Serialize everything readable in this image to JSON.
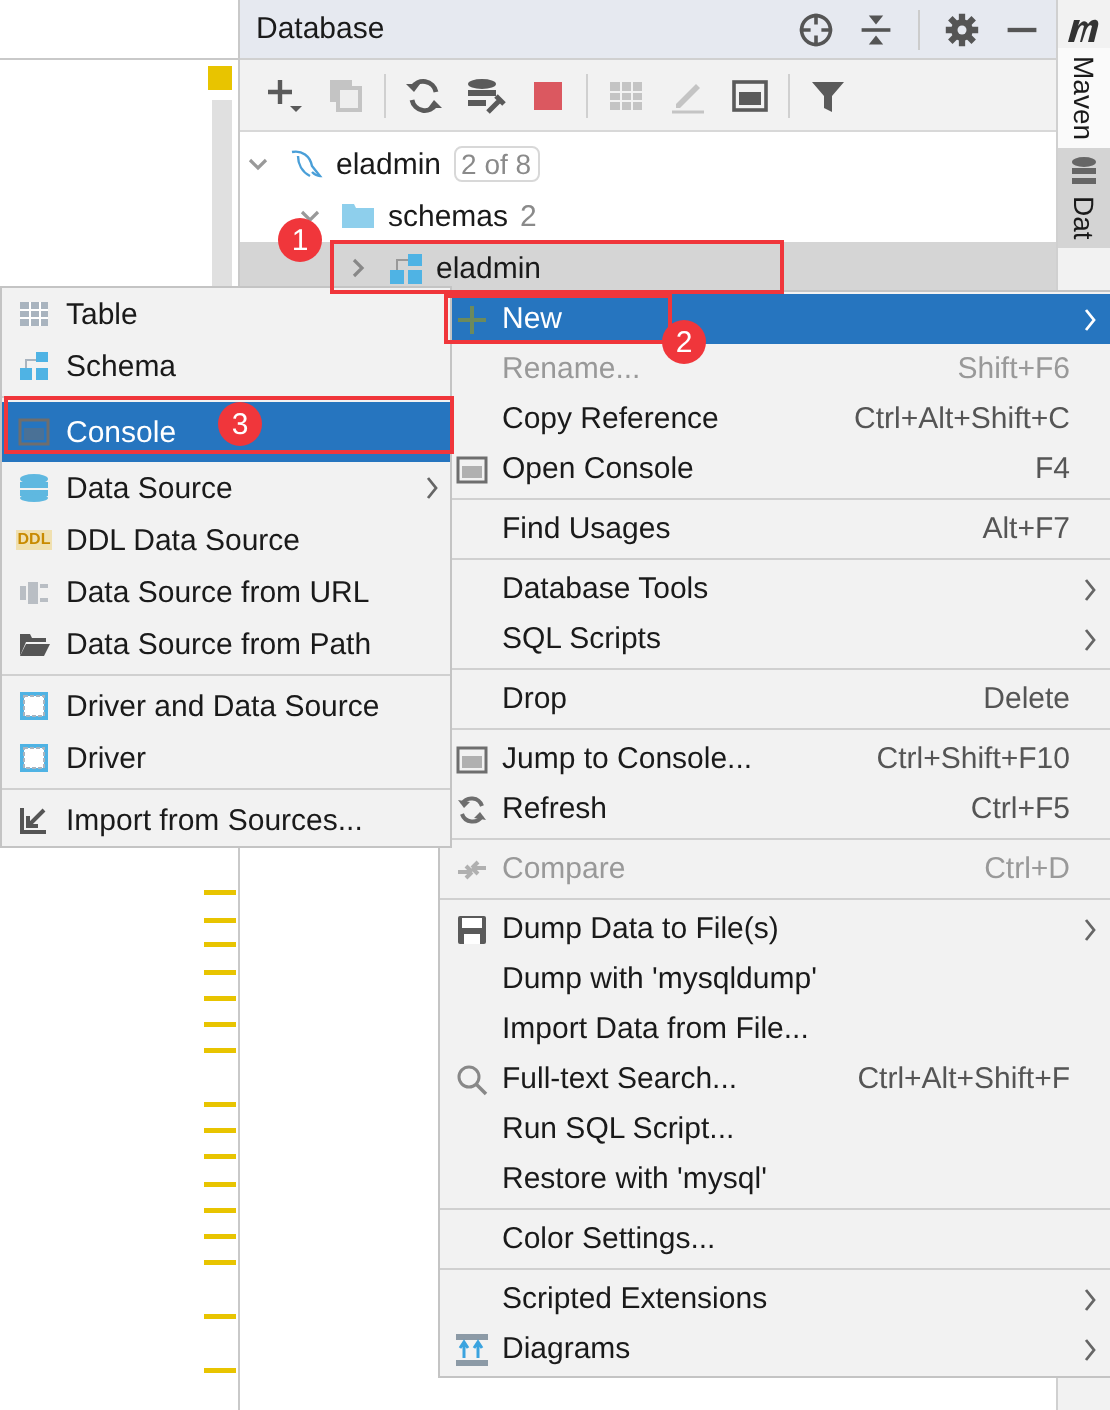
{
  "panel": {
    "title": "Database"
  },
  "toolbar": {
    "buttons": [
      {
        "disabled": false
      },
      {
        "disabled": true
      },
      {
        "disabled": false
      },
      {
        "disabled": false
      },
      {
        "disabled": false
      },
      {
        "disabled": true
      },
      {
        "disabled": true
      },
      {
        "disabled": false
      },
      {
        "disabled": false
      }
    ]
  },
  "side_tabs": [
    {
      "label": "Maven",
      "selected": false
    },
    {
      "label": "Dat",
      "selected": true
    }
  ],
  "tree": [
    {
      "label": "eladmin",
      "badge": "2 of 8",
      "expanded": true,
      "selected": false,
      "children": [
        {
          "label": "schemas",
          "count": "2",
          "expanded": true,
          "selected": false,
          "children": [
            {
              "label": "eladmin",
              "expanded": false,
              "selected": true
            }
          ]
        }
      ]
    }
  ],
  "new_submenu": {
    "groups": [
      [
        {
          "label": "Table",
          "selected": false,
          "submenu": false
        },
        {
          "label": "Schema",
          "selected": false,
          "submenu": false
        }
      ],
      [
        {
          "label": "Console",
          "selected": true,
          "submenu": false
        },
        {
          "label": "Data Source",
          "selected": false,
          "submenu": true
        },
        {
          "label": "DDL Data Source",
          "icon_text": "DDL",
          "selected": false,
          "submenu": false
        },
        {
          "label": "Data Source from URL",
          "selected": false,
          "submenu": false
        },
        {
          "label": "Data Source from Path",
          "selected": false,
          "submenu": false
        }
      ],
      [
        {
          "label": "Driver and Data Source",
          "selected": false,
          "submenu": false
        },
        {
          "label": "Driver",
          "selected": false,
          "submenu": false
        }
      ],
      [
        {
          "label": "Import from Sources...",
          "selected": false,
          "submenu": false
        }
      ]
    ]
  },
  "context_menu": {
    "groups": [
      [
        {
          "label": "New",
          "selected": true,
          "disabled": false,
          "submenu": true
        },
        {
          "label": "Rename...",
          "shortcut": "Shift+F6",
          "selected": false,
          "disabled": true,
          "submenu": false
        },
        {
          "label": "Copy Reference",
          "shortcut": "Ctrl+Alt+Shift+C",
          "selected": false,
          "disabled": false,
          "submenu": false
        },
        {
          "label": "Open Console",
          "shortcut": "F4",
          "selected": false,
          "disabled": false,
          "submenu": false
        }
      ],
      [
        {
          "label": "Find Usages",
          "shortcut": "Alt+F7",
          "selected": false,
          "disabled": false,
          "submenu": false
        }
      ],
      [
        {
          "label": "Database Tools",
          "selected": false,
          "disabled": false,
          "submenu": true
        },
        {
          "label": "SQL Scripts",
          "selected": false,
          "disabled": false,
          "submenu": true
        }
      ],
      [
        {
          "label": "Drop",
          "shortcut": "Delete",
          "selected": false,
          "disabled": false,
          "submenu": false
        }
      ],
      [
        {
          "label": "Jump to Console...",
          "shortcut": "Ctrl+Shift+F10",
          "selected": false,
          "disabled": false,
          "submenu": false
        },
        {
          "label": "Refresh",
          "shortcut": "Ctrl+F5",
          "selected": false,
          "disabled": false,
          "submenu": false
        }
      ],
      [
        {
          "label": "Compare",
          "shortcut": "Ctrl+D",
          "selected": false,
          "disabled": true,
          "submenu": false
        }
      ],
      [
        {
          "label": "Dump Data to File(s)",
          "selected": false,
          "disabled": false,
          "submenu": true
        },
        {
          "label": "Dump with 'mysqldump'",
          "selected": false,
          "disabled": false,
          "submenu": false
        },
        {
          "label": "Import Data from File...",
          "selected": false,
          "disabled": false,
          "submenu": false
        },
        {
          "label": "Full-text Search...",
          "shortcut": "Ctrl+Alt+Shift+F",
          "selected": false,
          "disabled": false,
          "submenu": false
        },
        {
          "label": "Run SQL Script...",
          "selected": false,
          "disabled": false,
          "submenu": false
        },
        {
          "label": "Restore with 'mysql'",
          "selected": false,
          "disabled": false,
          "submenu": false
        }
      ],
      [
        {
          "label": "Color Settings...",
          "selected": false,
          "disabled": false,
          "submenu": false
        }
      ],
      [
        {
          "label": "Scripted Extensions",
          "selected": false,
          "disabled": false,
          "submenu": true
        },
        {
          "label": "Diagrams",
          "selected": false,
          "disabled": false,
          "submenu": true
        }
      ]
    ]
  },
  "annotations": [
    {
      "number": "1"
    },
    {
      "number": "2"
    },
    {
      "number": "3"
    }
  ]
}
